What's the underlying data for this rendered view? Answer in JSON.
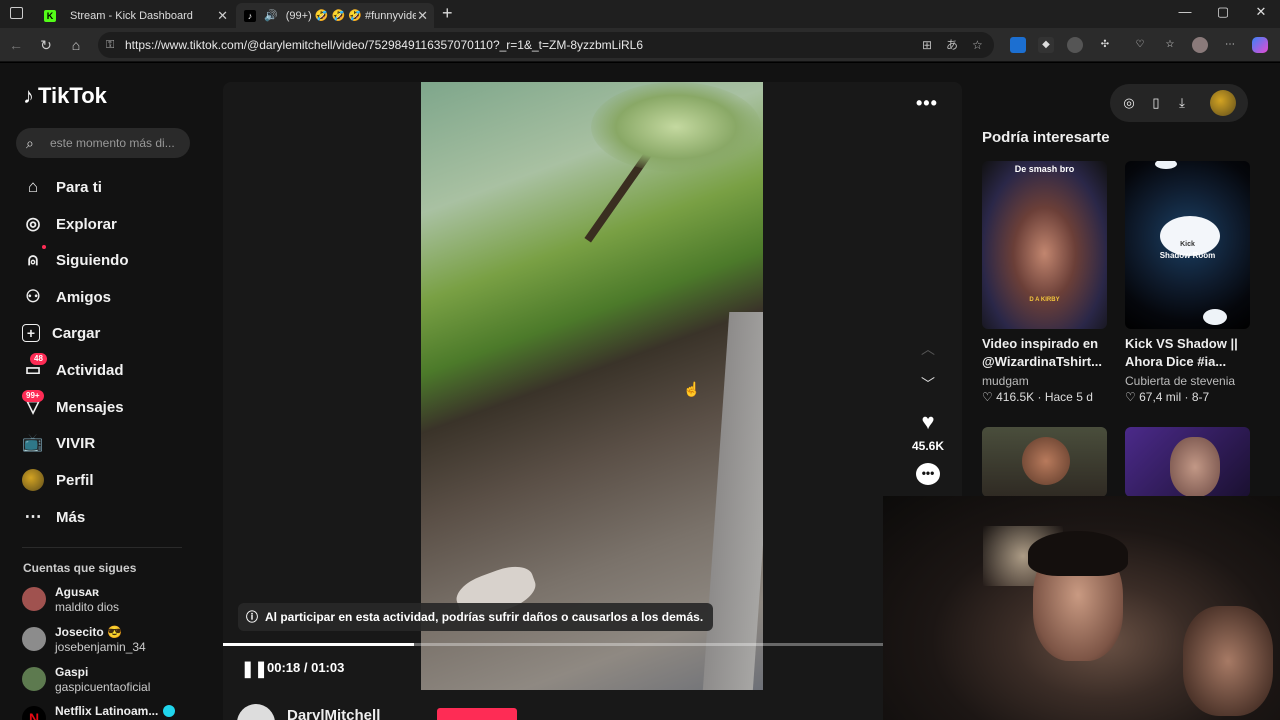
{
  "browser": {
    "tabs": [
      {
        "title": "Stream - Kick Dashboard",
        "active": false
      },
      {
        "title": "(99+) 🤣 🤣 🤣 #funnyvideos",
        "active": true
      }
    ],
    "url": "https://www.tiktok.com/@darylemitchell/video/7529849116357070110?_r=1&_t=ZM-8yzzbmLiRL6"
  },
  "sidebar": {
    "logo": "TikTok",
    "search_placeholder": "este momento más di...",
    "nav": [
      {
        "label": "Para ti",
        "icon": "home-icon"
      },
      {
        "label": "Explorar",
        "icon": "compass-icon"
      },
      {
        "label": "Siguiendo",
        "icon": "following-icon"
      },
      {
        "label": "Amigos",
        "icon": "friends-icon"
      },
      {
        "label": "Cargar",
        "icon": "upload-icon"
      },
      {
        "label": "Actividad",
        "icon": "activity-icon",
        "badge": "48"
      },
      {
        "label": "Mensajes",
        "icon": "messages-icon",
        "badge": "99+"
      },
      {
        "label": "VIVIR",
        "icon": "live-icon"
      },
      {
        "label": "Perfil",
        "icon": "profile-avatar"
      },
      {
        "label": "Más",
        "icon": "more-icon"
      }
    ],
    "following_title": "Cuentas que sigues",
    "following": [
      {
        "name": "Agusᴀʀ",
        "handle": "maldito dios"
      },
      {
        "name": "Josecito 😎",
        "handle": "josebenjamin_34"
      },
      {
        "name": "Gaspi",
        "handle": "gaspicuentaoficial"
      },
      {
        "name": "Netflix Latinoam...",
        "handle": ""
      }
    ]
  },
  "video": {
    "warning": "Al participar en esta actividad, podrías sufrir daños o causarlos a los demás.",
    "time": "00:18 / 01:03",
    "progress_fraction": 0.29,
    "author": "DarylMitchell",
    "likes": "45.6K"
  },
  "recommendations": {
    "title": "Podría interesarte",
    "cards": [
      {
        "title": "Video inspirado en @WizardinaTshirt...",
        "author": "mudgam",
        "likes": "416.5K",
        "date": "Hace 5 d",
        "overlay_top": "De smash bro",
        "overlay_bottom": "D A KIRBY"
      },
      {
        "title": "Kick VS Shadow || Ahora Dice #ia...",
        "author": "Cubierta de stevenia",
        "likes": "67,4 mil",
        "date": "8-7",
        "overlay_top": "Kick",
        "overlay_bottom": "Shadow Room"
      }
    ]
  },
  "colors": {
    "accent": "#fe2c55",
    "background": "#121212"
  }
}
